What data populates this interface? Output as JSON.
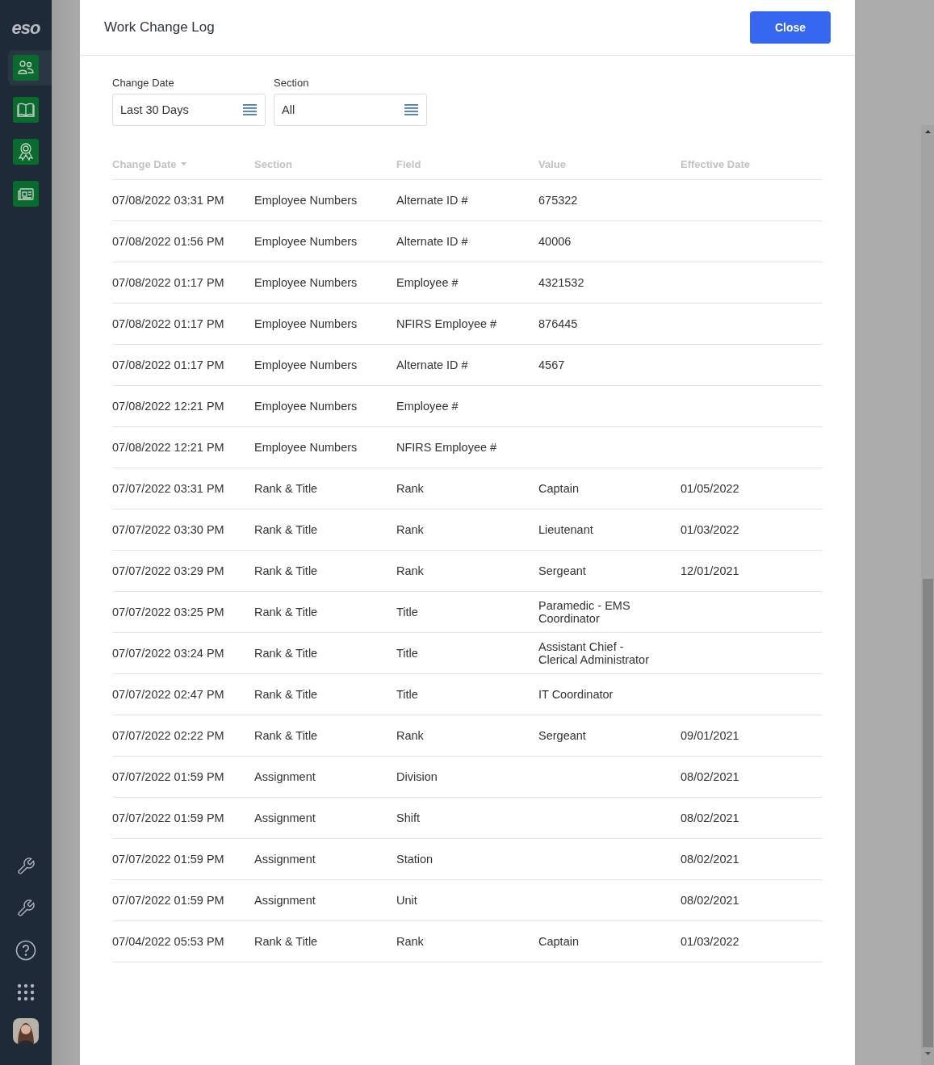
{
  "sidebar": {
    "logo": "eso",
    "nav": [
      {
        "selected": true
      },
      {
        "selected": false
      },
      {
        "selected": false
      },
      {
        "selected": false
      }
    ]
  },
  "dialog": {
    "title": "Work Change Log",
    "close_button": "Close"
  },
  "filters": [
    {
      "label": "Change Date",
      "value": "Last 30 Days"
    },
    {
      "label": "Section",
      "value": "All"
    }
  ],
  "table": {
    "columns": [
      {
        "label": "Change Date",
        "sorted": true
      },
      {
        "label": "Section",
        "sorted": false
      },
      {
        "label": "Field",
        "sorted": false
      },
      {
        "label": "Value",
        "sorted": false
      },
      {
        "label": "Effective Date",
        "sorted": false
      }
    ],
    "rows": [
      [
        "07/08/2022 03:31 PM",
        "Employee Numbers",
        "Alternate ID #",
        "675322",
        ""
      ],
      [
        "07/08/2022 01:56 PM",
        "Employee Numbers",
        "Alternate ID #",
        "40006",
        ""
      ],
      [
        "07/08/2022 01:17 PM",
        "Employee Numbers",
        "Employee #",
        "4321532",
        ""
      ],
      [
        "07/08/2022 01:17 PM",
        "Employee Numbers",
        "NFIRS Employee #",
        "876445",
        ""
      ],
      [
        "07/08/2022 01:17 PM",
        "Employee Numbers",
        "Alternate ID #",
        "4567",
        ""
      ],
      [
        "07/08/2022 12:21 PM",
        "Employee Numbers",
        "Employee #",
        "",
        ""
      ],
      [
        "07/08/2022 12:21 PM",
        "Employee Numbers",
        "NFIRS Employee #",
        "",
        ""
      ],
      [
        "07/07/2022 03:31 PM",
        "Rank & Title",
        "Rank",
        "Captain",
        "01/05/2022"
      ],
      [
        "07/07/2022 03:30 PM",
        "Rank & Title",
        "Rank",
        "Lieutenant",
        "01/03/2022"
      ],
      [
        "07/07/2022 03:29 PM",
        "Rank & Title",
        "Rank",
        "Sergeant",
        "12/01/2021"
      ],
      [
        "07/07/2022 03:25 PM",
        "Rank & Title",
        "Title",
        "Paramedic - EMS Coordinator",
        ""
      ],
      [
        "07/07/2022 03:24 PM",
        "Rank & Title",
        "Title",
        "Assistant Chief - Clerical Administrator",
        ""
      ],
      [
        "07/07/2022 02:47 PM",
        "Rank & Title",
        "Title",
        "IT Coordinator",
        ""
      ],
      [
        "07/07/2022 02:22 PM",
        "Rank & Title",
        "Rank",
        "Sergeant",
        "09/01/2021"
      ],
      [
        "07/07/2022 01:59 PM",
        "Assignment",
        "Division",
        "",
        "08/02/2021"
      ],
      [
        "07/07/2022 01:59 PM",
        "Assignment",
        "Shift",
        "",
        "08/02/2021"
      ],
      [
        "07/07/2022 01:59 PM",
        "Assignment",
        "Station",
        "",
        "08/02/2021"
      ],
      [
        "07/07/2022 01:59 PM",
        "Assignment",
        "Unit",
        "",
        "08/02/2021"
      ],
      [
        "07/04/2022 05:53 PM",
        "Rank & Title",
        "Rank",
        "Captain",
        "01/03/2022"
      ]
    ]
  }
}
